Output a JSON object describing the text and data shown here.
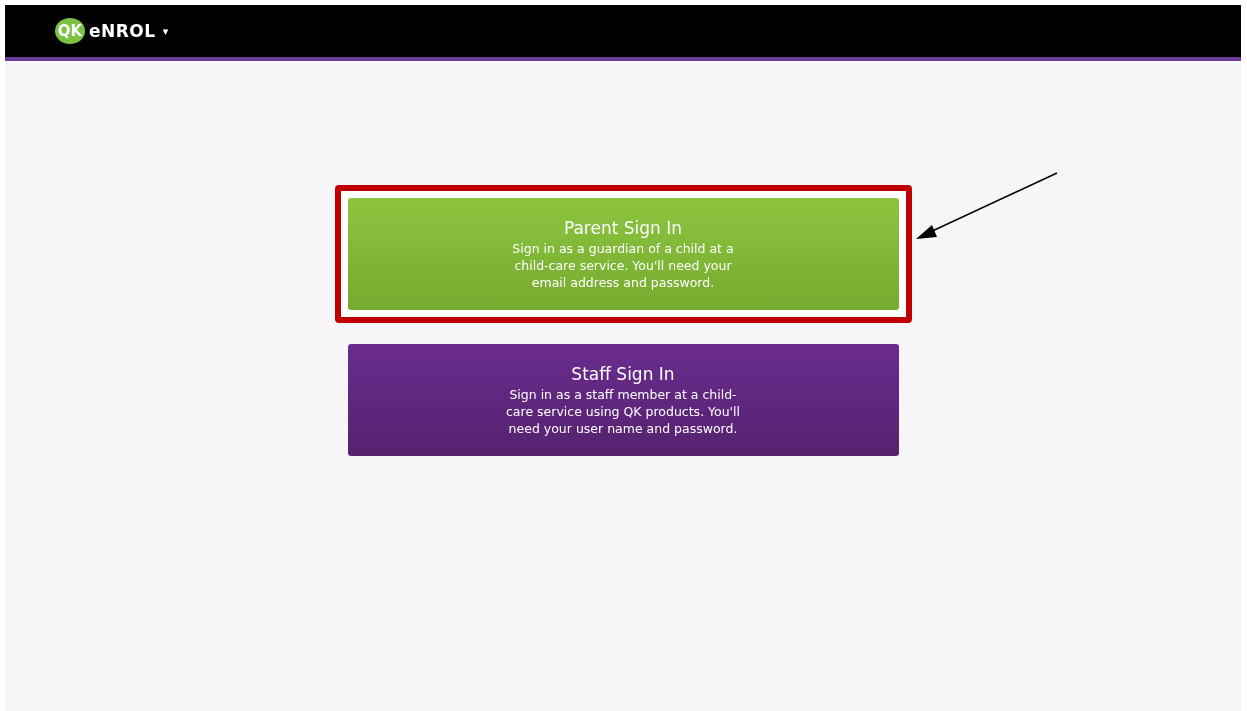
{
  "header": {
    "logo_badge": "QK",
    "logo_text": "eNROL",
    "menu_caret": "▾"
  },
  "options": [
    {
      "kind": "parent",
      "title": "Parent Sign In",
      "description": "Sign in as a guardian of a child at a\nchild-care service. You'll need your\nemail address and password.",
      "highlighted": true
    },
    {
      "kind": "staff",
      "title": "Staff Sign In",
      "description": "Sign in as a staff member at a child-\ncare service using QK products. You'll\nneed your user name and password.",
      "highlighted": false
    }
  ]
}
